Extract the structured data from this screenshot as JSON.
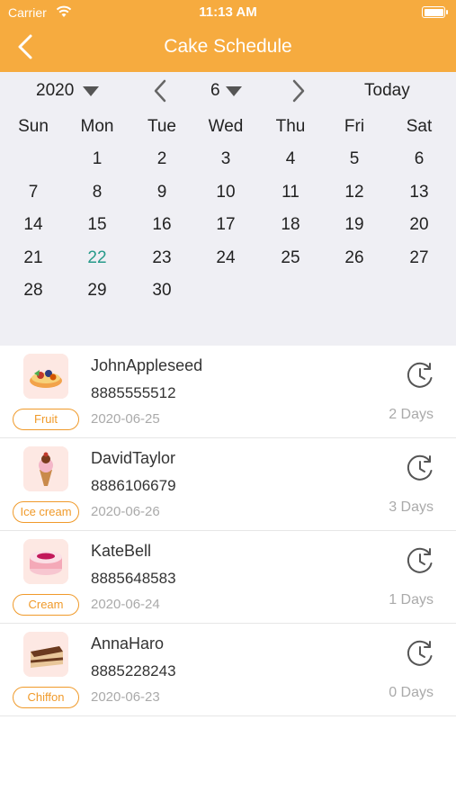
{
  "status_bar": {
    "carrier": "Carrier",
    "time": "11:13 AM"
  },
  "header": {
    "title": "Cake Schedule"
  },
  "calendar": {
    "year": "2020",
    "month": "6",
    "today_label": "Today",
    "weekdays": [
      "Sun",
      "Mon",
      "Tue",
      "Wed",
      "Thu",
      "Fri",
      "Sat"
    ],
    "selected_day": "22",
    "days": [
      "1",
      "2",
      "3",
      "4",
      "5",
      "6",
      "7",
      "8",
      "9",
      "10",
      "11",
      "12",
      "13",
      "14",
      "15",
      "16",
      "17",
      "18",
      "19",
      "20",
      "21",
      "22",
      "23",
      "24",
      "25",
      "26",
      "27",
      "28",
      "29",
      "30"
    ]
  },
  "orders": [
    {
      "name": "JohnAppleseed",
      "phone": "8885555512",
      "date": "2020-06-25",
      "tag": "Fruit",
      "days": "2 Days",
      "icon": "fruit-tart-icon"
    },
    {
      "name": "DavidTaylor",
      "phone": "8886106679",
      "date": "2020-06-26",
      "tag": "Ice cream",
      "days": "3 Days",
      "icon": "ice-cream-icon"
    },
    {
      "name": "KateBell",
      "phone": "8885648583",
      "date": "2020-06-24",
      "tag": "Cream",
      "days": "1 Days",
      "icon": "cream-cake-icon"
    },
    {
      "name": "AnnaHaro",
      "phone": "8885228243",
      "date": "2020-06-23",
      "tag": "Chiffon",
      "days": "0 Days",
      "icon": "chiffon-cake-icon"
    }
  ],
  "colors": {
    "accent": "#f6ab3f",
    "selected": "#a6d8cf",
    "selected_text": "#279a8a",
    "tag": "#f09a2a"
  }
}
